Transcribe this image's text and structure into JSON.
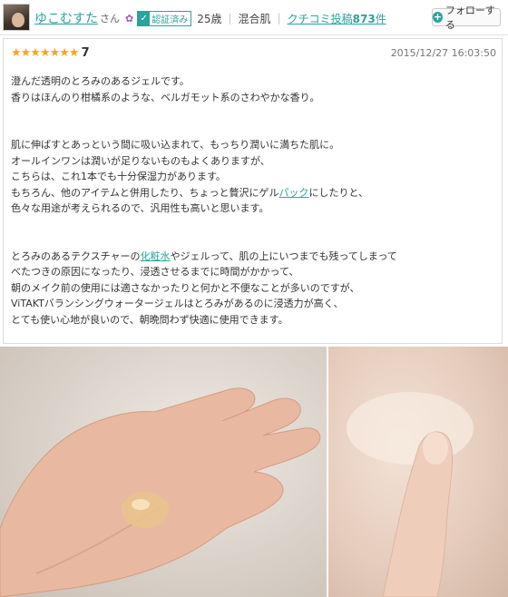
{
  "header": {
    "username": "ゆこむすた",
    "honorific": "さん",
    "flower_icon": "flower-icon",
    "verified_label": "認証済み",
    "age": "25歳",
    "skin_type": "混合肌",
    "posts_prefix": "クチコミ投稿",
    "posts_count": "873",
    "posts_suffix": "件",
    "follow_label": "フォローする"
  },
  "review": {
    "stars": "★★★★★★★",
    "rating": "7",
    "date": "2015/12/27 16:03:50",
    "p1_l1": "澄んだ透明のとろみのあるジェルです。",
    "p1_l2": "香りはほんのり柑橘系のような、ベルガモット系のさわやかな香り。",
    "p2_l1": "肌に伸ばすとあっという間に吸い込まれて、もっちり潤いに満ちた肌に。",
    "p2_l2": "オールインワンは潤いが足りないものもよくありますが、",
    "p2_l3": "こちらは、これ1本でも十分保湿力があります。",
    "p2_l4_a": "もちろん、他のアイテムと併用したり、ちょっと贅沢にゲル",
    "p2_l4_link": "パック",
    "p2_l4_b": "にしたりと、",
    "p2_l5": "色々な用途が考えられるので、汎用性も高いと思います。",
    "p3_l1_a": "とろみのあるテクスチャーの",
    "p3_l1_link": "化粧水",
    "p3_l1_b": "やジェルって、肌の上にいつまでも残ってしまって",
    "p3_l2": "べたつきの原因になったり、浸透させるまでに時間がかかって、",
    "p3_l3": "朝のメイク前の使用には適さなかったりと何かと不便なことが多いのですが、",
    "p3_l4": "ViTAKTバランシングウォータージェルはとろみがあるのに浸透力が高く、",
    "p3_l5": "とても使い心地が良いので、朝晩問わず快適に使用できます。"
  },
  "colors": {
    "accent": "#2aa39d",
    "star": "#f5a623"
  }
}
